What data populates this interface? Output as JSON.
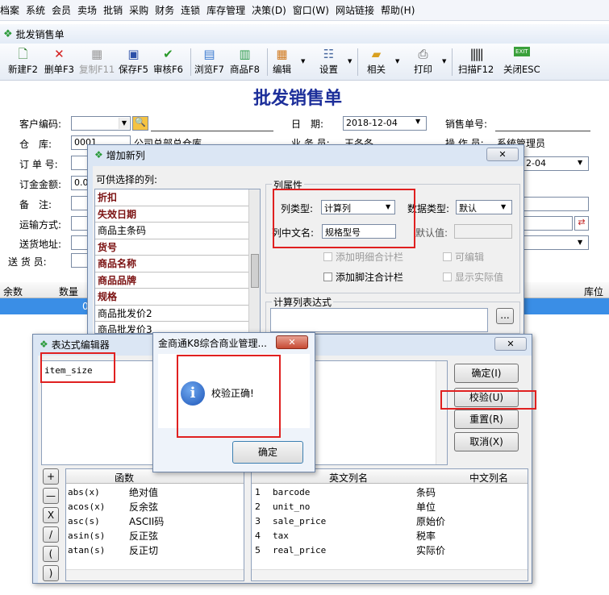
{
  "menu": [
    "档案",
    "系统",
    "会员",
    "卖场",
    "批销",
    "采购",
    "财务",
    "连锁",
    "库存管理",
    "决策(D)",
    "窗口(W)",
    "网站链接",
    "帮助(H)"
  ],
  "window_title": "批发销售单",
  "toolbar": {
    "new": "新建F2",
    "delete": "删单F3",
    "copy": "复制F11",
    "save": "保存F5",
    "audit": "审核F6",
    "browse": "浏览F7",
    "product": "商品F8",
    "edit": "编辑",
    "settings": "设置",
    "related": "相关",
    "print": "打印",
    "scan": "扫描F12",
    "close": "关闭ESC"
  },
  "form": {
    "title": "批发销售单",
    "customer_code_label": "客户编码:",
    "warehouse_label": "仓　库:",
    "warehouse_value": "0001",
    "warehouse_name": "公司总部总仓库",
    "order_no_label": "订 单 号:",
    "order_amount_label": "订金金额:",
    "order_amount_value": "0.00",
    "remark_label": "备　注:",
    "shipping_label": "运输方式:",
    "address_label": "送货地址:",
    "deliverer_label": "送 货 员:",
    "date_label": "日　期:",
    "date_value": "2018-12-04",
    "salesman_label": "业 务 员:",
    "salesman_value": "王冬冬",
    "sales_no_label": "销售单号:",
    "operator_label": "操 作 员:",
    "operator_value": "系统管理员",
    "date2_value": "2-04"
  },
  "grid": {
    "headers": [
      "余数",
      "数量",
      "库位"
    ],
    "first_row_qty": "0"
  },
  "add_column_dialog": {
    "title": "增加新列",
    "available_label": "可供选择的列:",
    "columns": [
      {
        "name": "折扣",
        "bold": true
      },
      {
        "name": "失效日期",
        "bold": true
      },
      {
        "name": "商品主条码",
        "bold": false
      },
      {
        "name": "货号",
        "bold": true
      },
      {
        "name": "商品名称",
        "bold": true
      },
      {
        "name": "商品品牌",
        "bold": true
      },
      {
        "name": "规格",
        "bold": true
      },
      {
        "name": "商品批发价2",
        "bold": false
      },
      {
        "name": "商品批发价3",
        "bold": false
      }
    ],
    "props_group": "列属性",
    "col_type_label": "列类型:",
    "col_type_value": "计算列",
    "data_type_label": "数据类型:",
    "data_type_value": "默认",
    "cn_name_label": "列中文名:",
    "cn_name_value": "规格型号",
    "default_label": "默认值:",
    "chk_detail_total": "添加明细合计栏",
    "chk_editable": "可编辑",
    "chk_footer_total": "添加脚注合计栏",
    "chk_show_actual": "显示实际值",
    "expr_group": "计算列表达式",
    "ellipsis": "..."
  },
  "expr_editor": {
    "title": "表达式编辑器",
    "expression": "item_size",
    "buttons": {
      "ok": "确定(I)",
      "verify": "校验(U)",
      "reset": "重置(R)",
      "cancel": "取消(X)"
    },
    "ops": [
      "+",
      "—",
      "X",
      "/",
      "(",
      ")"
    ],
    "func_header": "函数",
    "functions": [
      {
        "name": "abs(x)",
        "desc": "绝对值"
      },
      {
        "name": "acos(x)",
        "desc": "反余弦"
      },
      {
        "name": "asc(s)",
        "desc": "ASCII码"
      },
      {
        "name": "asin(s)",
        "desc": "反正弦"
      },
      {
        "name": "atan(s)",
        "desc": "反正切"
      }
    ],
    "field_header_en": "英文列名",
    "field_header_cn": "中文列名",
    "fields": [
      {
        "no": "1",
        "en": "barcode",
        "cn": "条码"
      },
      {
        "no": "2",
        "en": "unit_no",
        "cn": "单位"
      },
      {
        "no": "3",
        "en": "sale_price",
        "cn": "原始价"
      },
      {
        "no": "4",
        "en": "tax",
        "cn": "税率"
      },
      {
        "no": "5",
        "en": "real_price",
        "cn": "实际价"
      }
    ]
  },
  "msgbox": {
    "title": "金商通K8综合商业管理...",
    "message": "校验正确!",
    "ok": "确定",
    "icon": "info-icon"
  },
  "close_glyph": "✕"
}
